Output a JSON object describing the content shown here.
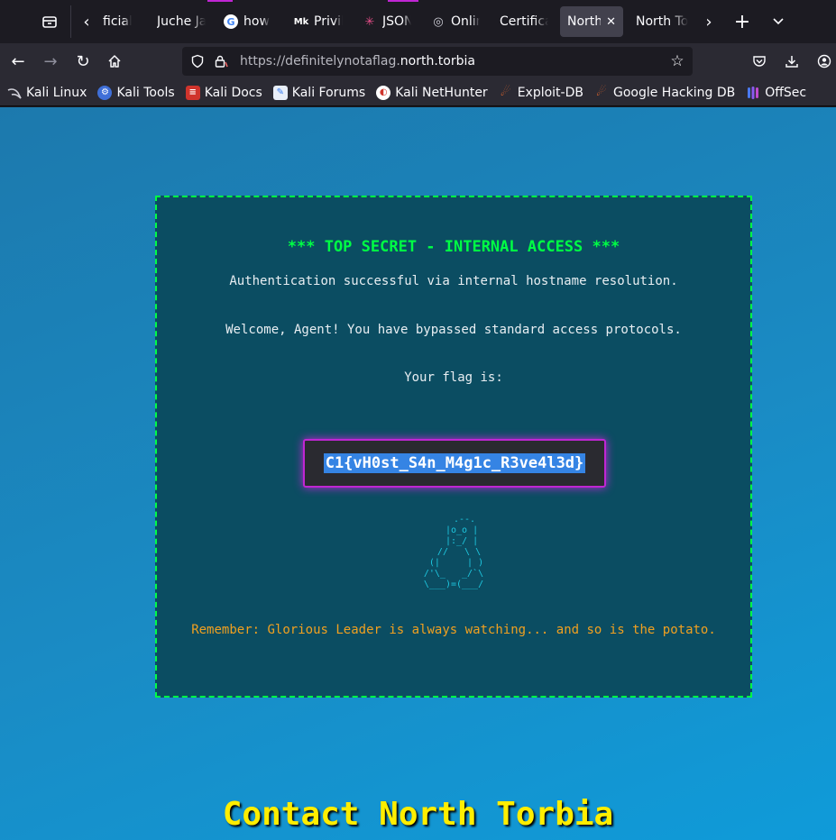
{
  "tabs": [
    {
      "title": "ficial S",
      "favicon": "",
      "color": ""
    },
    {
      "title": "Juche Ja",
      "favicon": "",
      "color": ""
    },
    {
      "title": "how",
      "favicon": "G",
      "color": "#ffffff"
    },
    {
      "title": "Privil",
      "favicon": "Mk",
      "color": "#ffffff"
    },
    {
      "title": "JSON",
      "favicon": "✳",
      "color": "#e84e8a"
    },
    {
      "title": "Onlin",
      "favicon": "◎",
      "color": "#cfcfd8"
    },
    {
      "title": "Certifica",
      "favicon": "",
      "color": ""
    },
    {
      "title": "North",
      "favicon": "",
      "color": "",
      "active": true,
      "close": "✕"
    },
    {
      "title": "North To",
      "favicon": "",
      "color": ""
    }
  ],
  "tabbar": {
    "list_all_icon": "tab-list-icon",
    "scroll_left": "‹",
    "scroll_right": "›",
    "new_tab": "+",
    "overflow": "⌄"
  },
  "nav": {
    "back": "←",
    "forward": "→",
    "reload": "↻",
    "home": "⌂",
    "url_prefix": "https://definitelynotaflag.",
    "url_host": "north.torbia",
    "pocket": "pocket-icon",
    "downloads": "downloads-icon",
    "account": "account-icon"
  },
  "bookmarks": [
    {
      "label": "Kali Linux",
      "icon_color": "#367bf0"
    },
    {
      "label": "Kali Tools",
      "icon_color": "#3f6fd8"
    },
    {
      "label": "Kali Docs",
      "icon_color": "#d0342c"
    },
    {
      "label": "Kali Forums",
      "icon_color": "#367bf0"
    },
    {
      "label": "Kali NetHunter",
      "icon_color": "#d0342c"
    },
    {
      "label": "Exploit-DB",
      "icon_color": "#e8682c"
    },
    {
      "label": "Google Hacking DB",
      "icon_color": "#e8682c"
    },
    {
      "label": "OffSec",
      "icon_color": "#6b6bf0"
    }
  ],
  "page": {
    "title": "*** TOP SECRET - INTERNAL ACCESS ***",
    "line1": "Authentication successful via internal hostname resolution.",
    "line2": "Welcome, Agent! You have bypassed standard access protocols.",
    "line3": "Your flag is:",
    "flag": "C1{vH0st_S4n_M4g1c_R3ve4l3d}",
    "ascii_art": "    .--.\n   |o_o |\n   |:_/ |\n  //   \\ \\\n (|     | )\n/'\\_   _/`\\\n\\___)=(___/",
    "reminder": "Remember: Glorious Leader is always watching... and so is the potato.",
    "contact_title": "Contact North Torbia"
  },
  "colors": {
    "accent_green": "#00ff44",
    "flag_border": "#c026d3",
    "contact_yellow": "#ffee00",
    "reminder_orange": "#f0a020"
  }
}
